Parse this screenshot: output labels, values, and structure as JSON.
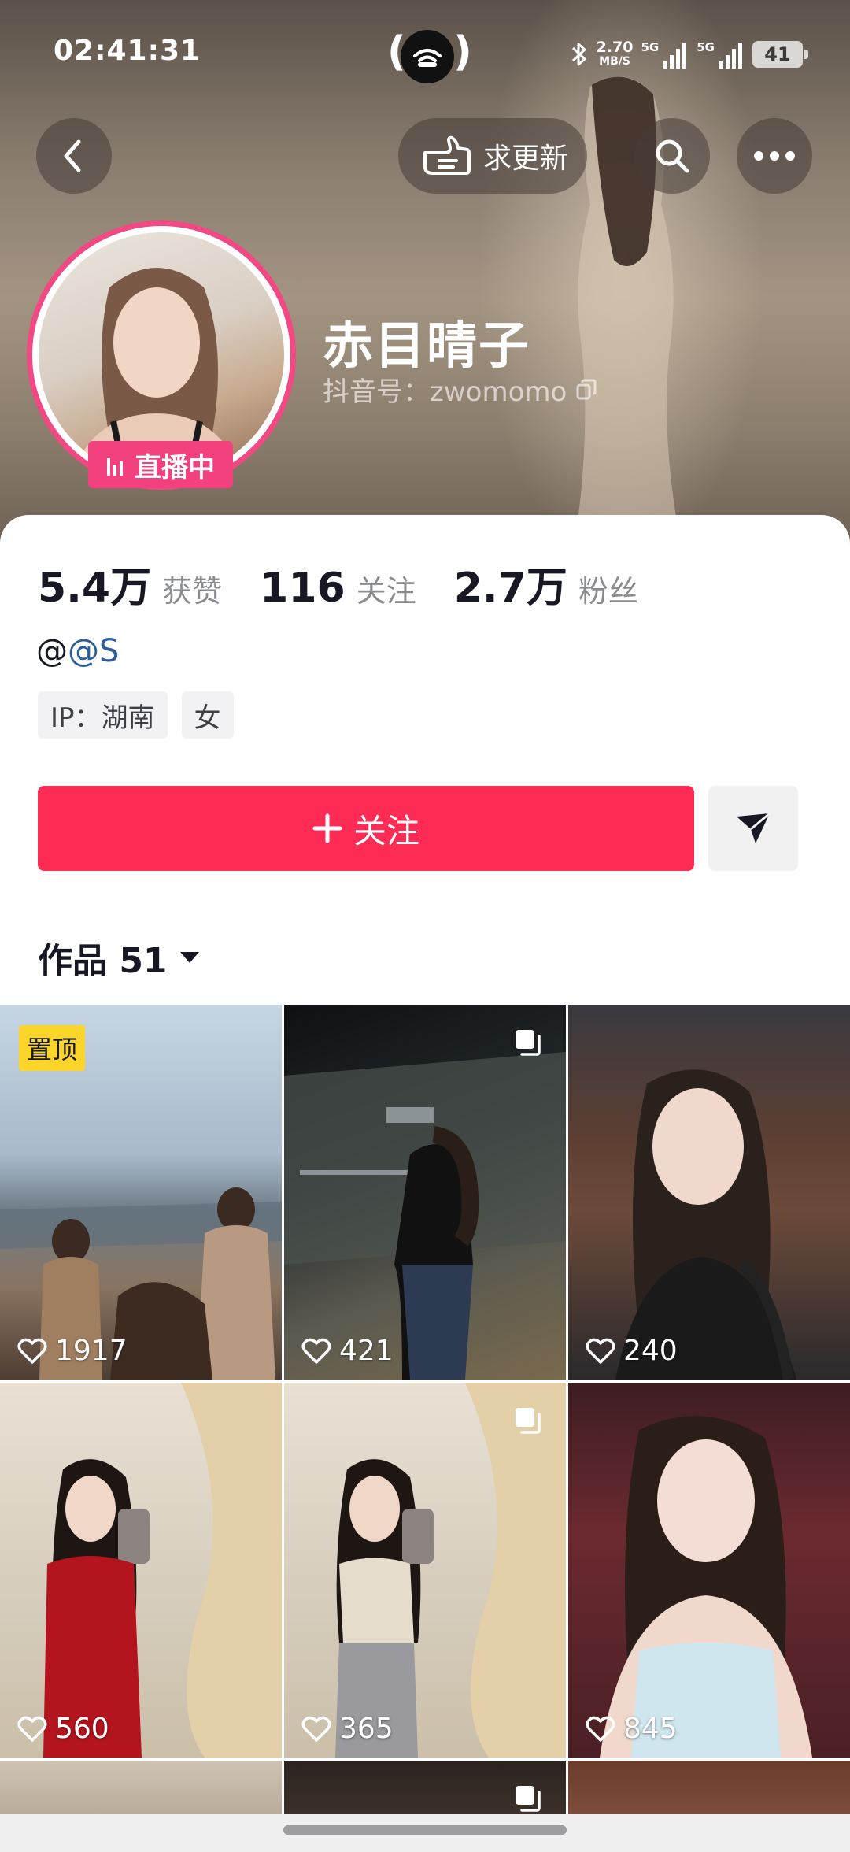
{
  "status_bar": {
    "time": "02:41:31",
    "net_speed_value": "2.70",
    "net_speed_unit": "MB/S",
    "signal1_label": "5G",
    "signal2_label": "5G",
    "battery": "41"
  },
  "header": {
    "request_update_label": "求更新"
  },
  "profile": {
    "nickname": "赤目晴子",
    "douyin_id": "抖音号：zwomomo",
    "live_label": "直播中"
  },
  "stats": {
    "likes_value": "5.4万",
    "likes_label": "获赞",
    "following_value": "116",
    "following_label": "关注",
    "followers_value": "2.7万",
    "followers_label": "粉丝"
  },
  "bio": {
    "prefix": "@",
    "mention": "@S"
  },
  "tags": [
    "IP：湖南",
    "女"
  ],
  "actions": {
    "follow_label": "关注"
  },
  "works_tab": {
    "label": "作品 51"
  },
  "videos": [
    {
      "likes": "1917",
      "pinned_label": "置顶",
      "multi": false
    },
    {
      "likes": "421",
      "multi": true
    },
    {
      "likes": "240",
      "multi": false
    },
    {
      "likes": "560",
      "multi": false
    },
    {
      "likes": "365",
      "multi": true
    },
    {
      "likes": "845",
      "multi": false
    }
  ],
  "colors": {
    "follow_button": "#fe2c55",
    "live_ring": "#f24883",
    "pinned_badge": "#fcd52a"
  }
}
